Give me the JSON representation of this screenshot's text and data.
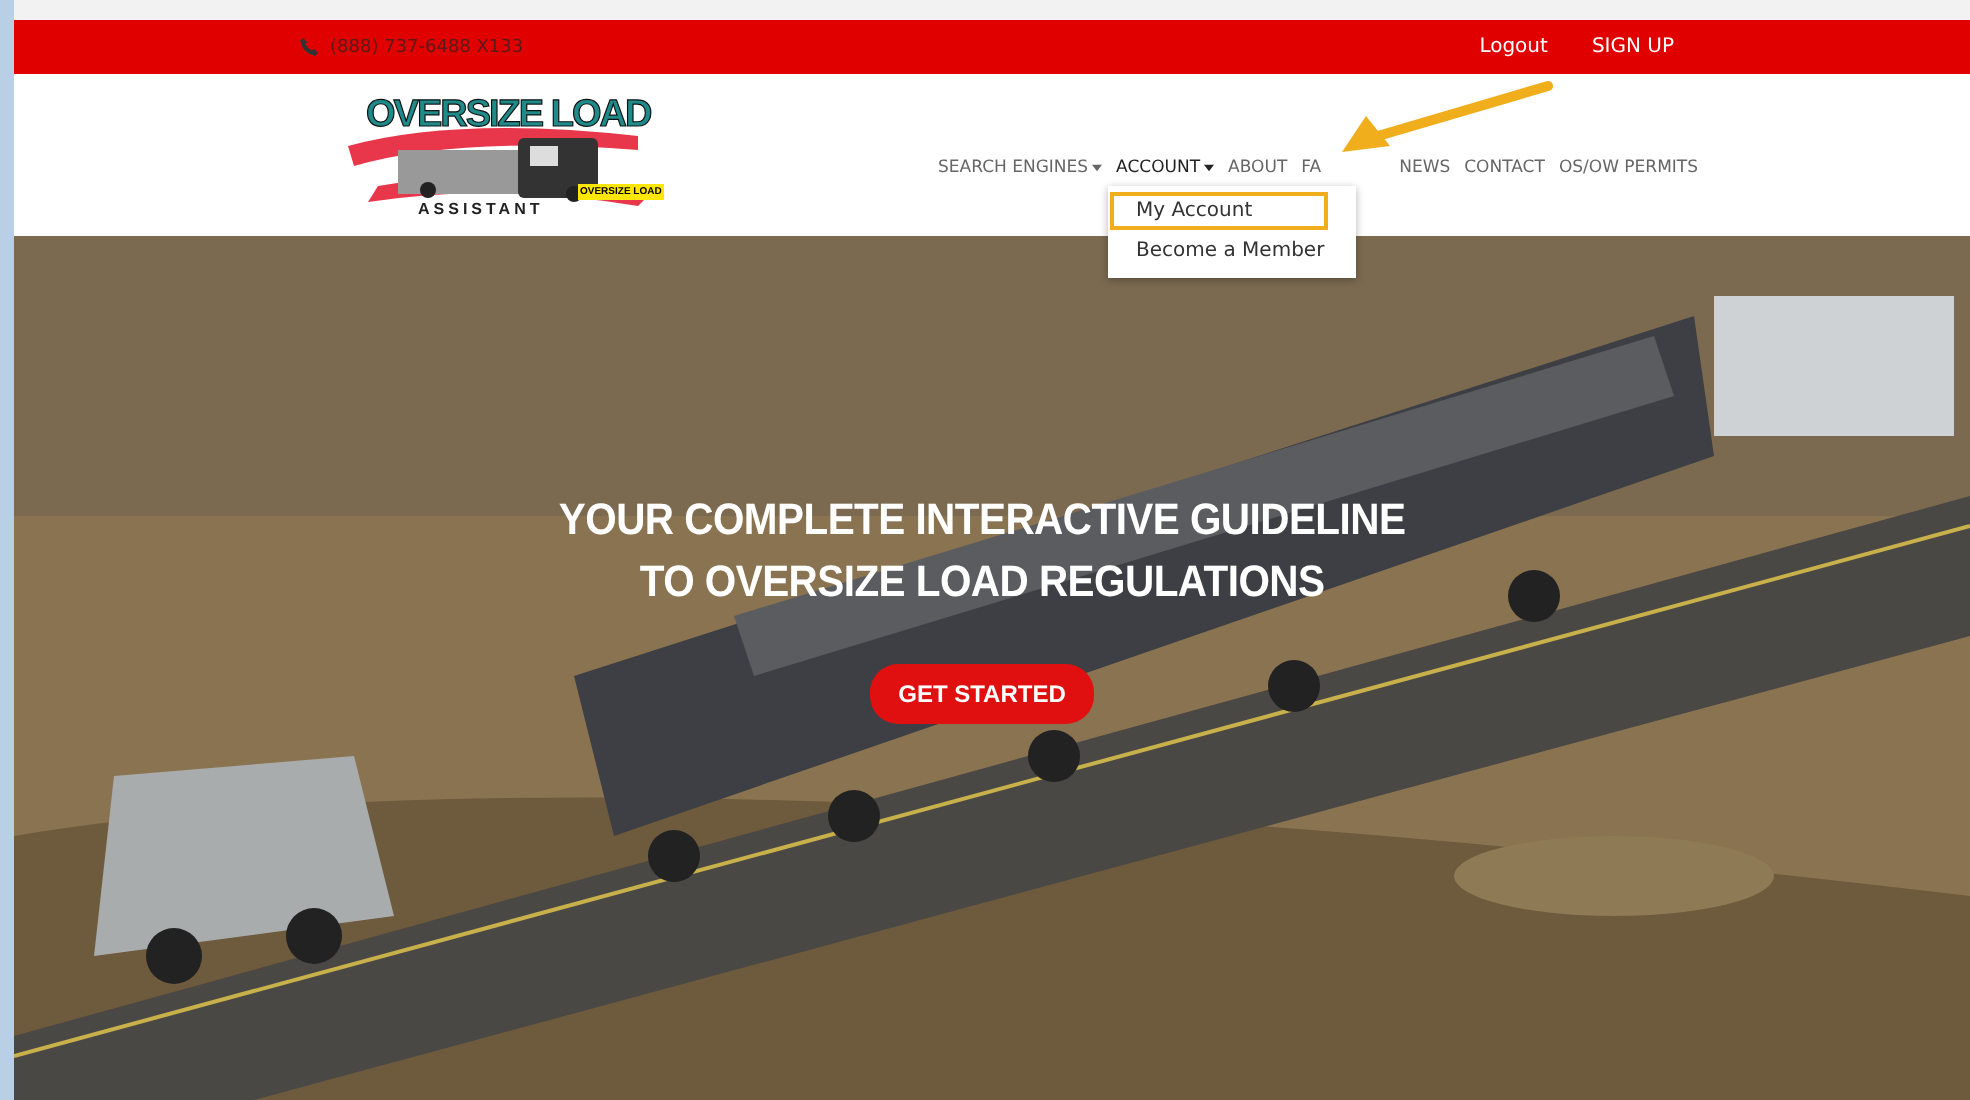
{
  "top_bar": {
    "phone": "(888) 737-6488 X133",
    "links": [
      "Logout",
      "SIGN UP"
    ]
  },
  "logo": {
    "title": "OVERSIZE LOAD",
    "subtitle": "ASSISTANT",
    "badge": "OVERSIZE LOAD"
  },
  "nav": [
    {
      "label": "SEARCH ENGINES",
      "dropdown": true,
      "active": false
    },
    {
      "label": "ACCOUNT",
      "dropdown": true,
      "active": true
    },
    {
      "label": "ABOUT",
      "dropdown": false,
      "active": false
    },
    {
      "label": "FA",
      "dropdown": false,
      "active": false
    },
    {
      "label": "NEWS",
      "dropdown": false,
      "active": false
    },
    {
      "label": "CONTACT",
      "dropdown": false,
      "active": false
    },
    {
      "label": "OS/OW PERMITS",
      "dropdown": false,
      "active": false
    }
  ],
  "account_menu": [
    {
      "label": "My Account",
      "highlighted": true
    },
    {
      "label": "Become a Member",
      "highlighted": false
    }
  ],
  "hero": {
    "kind": "picture",
    "headline": [
      "YOUR COMPLETE INTERACTIVE GUIDELINE",
      "TO OVERSIZE LOAD REGULATIONS"
    ],
    "button": "GET STARTED"
  }
}
